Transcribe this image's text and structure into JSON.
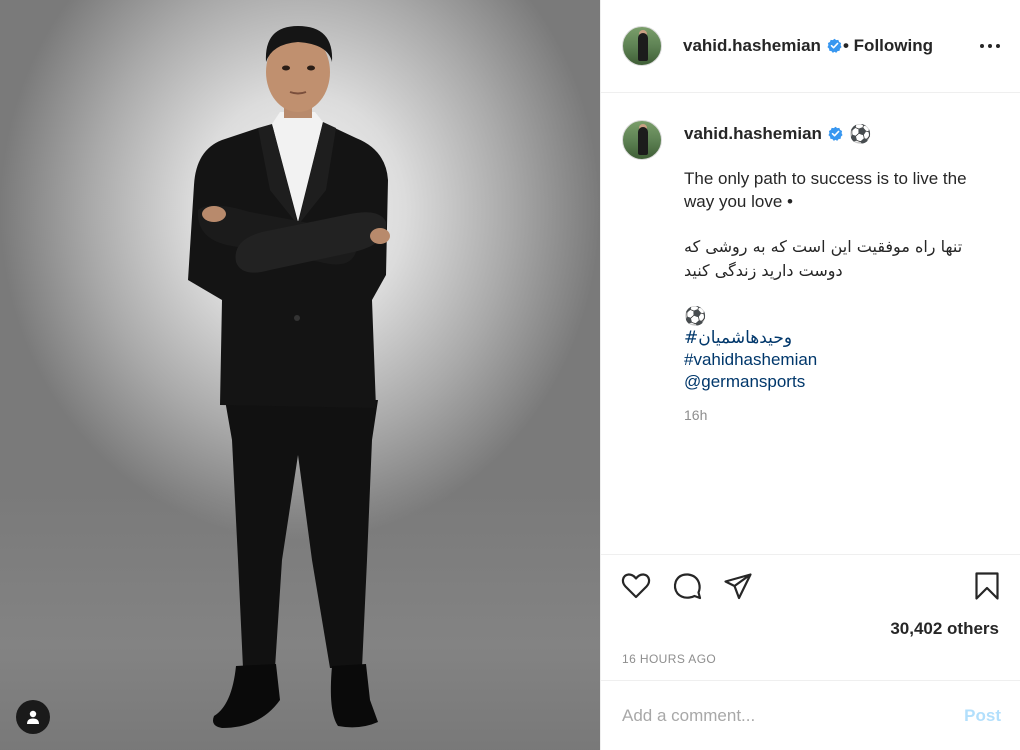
{
  "post": {
    "author": "vahid.hashemian",
    "follow_status": "• Following",
    "caption_lines": [
      "The only path to success is to live the way you love •",
      "تنها راه موفقیت این است که به روشی که دوست دارید زندگی کنید",
      "⚽"
    ],
    "caption_emoji": "⚽",
    "hashtags": [
      "#وحیدهاشمیان",
      "#vahidhashemian"
    ],
    "mention": "@germansports",
    "caption_time": "16h",
    "likes": "30,402 others",
    "posted": "16 HOURS AGO"
  },
  "comment": {
    "placeholder": "Add a comment...",
    "post_label": "Post"
  },
  "icons": {
    "verified": "verified-badge-icon",
    "more": "more-options-icon",
    "like": "heart-icon",
    "comment": "comment-icon",
    "share": "share-icon",
    "save": "bookmark-icon",
    "tags": "user-tags-icon"
  },
  "colors": {
    "link": "#00376b",
    "verified": "#3897f0",
    "muted": "#8e8e8e",
    "post_disabled": "#b2dffc"
  }
}
